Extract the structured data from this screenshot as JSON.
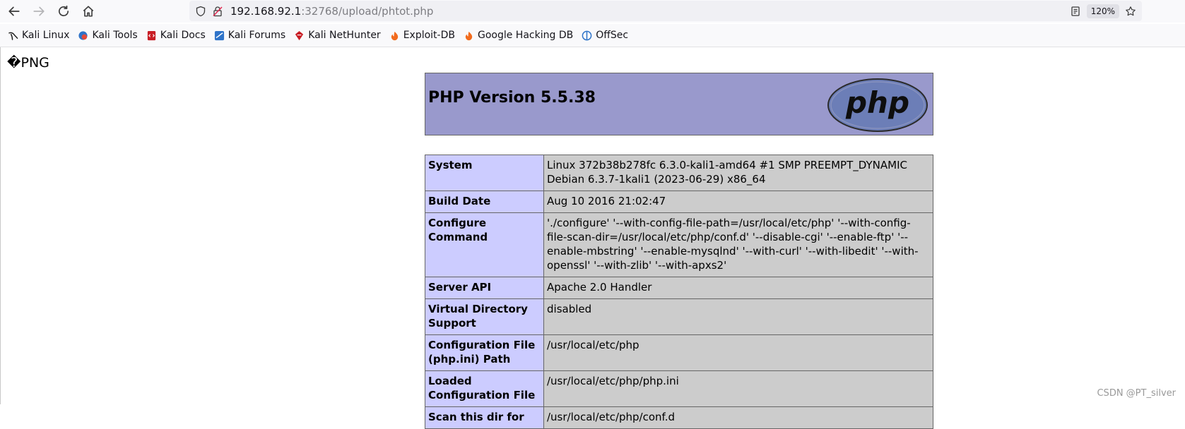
{
  "toolbar": {
    "url_host": "192.168.92.1",
    "url_path": ":32768/upload/phtot.php",
    "zoom": "120%"
  },
  "bookmarks": [
    {
      "label": "Kali Linux",
      "icon": "kali-dragon-icon"
    },
    {
      "label": "Kali Tools",
      "icon": "kali-tools-icon"
    },
    {
      "label": "Kali Docs",
      "icon": "kali-docs-icon"
    },
    {
      "label": "Kali Forums",
      "icon": "kali-forums-icon"
    },
    {
      "label": "Kali NetHunter",
      "icon": "kali-nethunter-icon"
    },
    {
      "label": "Exploit-DB",
      "icon": "exploit-db-icon"
    },
    {
      "label": "Google Hacking DB",
      "icon": "ghdb-icon"
    },
    {
      "label": "OffSec",
      "icon": "offsec-icon"
    }
  ],
  "page": {
    "garbage_text": "�PNG",
    "php_version": "PHP Version 5.5.38",
    "logo_text": "php",
    "rows": [
      {
        "key": "System",
        "value": "Linux 372b38b278fc 6.3.0-kali1-amd64 #1 SMP PREEMPT_DYNAMIC Debian 6.3.7-1kali1 (2023-06-29) x86_64"
      },
      {
        "key": "Build Date",
        "value": "Aug 10 2016 21:02:47"
      },
      {
        "key": "Configure Command",
        "value": "'./configure' '--with-config-file-path=/usr/local/etc/php' '--with-config-file-scan-dir=/usr/local/etc/php/conf.d' '--disable-cgi' '--enable-ftp' '--enable-mbstring' '--enable-mysqlnd' '--with-curl' '--with-libedit' '--with-openssl' '--with-zlib' '--with-apxs2'"
      },
      {
        "key": "Server API",
        "value": "Apache 2.0 Handler"
      },
      {
        "key": "Virtual Directory Support",
        "value": "disabled"
      },
      {
        "key": "Configuration File (php.ini) Path",
        "value": "/usr/local/etc/php"
      },
      {
        "key": "Loaded Configuration File",
        "value": "/usr/local/etc/php/php.ini"
      },
      {
        "key": "Scan this dir for",
        "value": "/usr/local/etc/php/conf.d"
      }
    ],
    "watermark": "CSDN @PT_silver"
  },
  "colors": {
    "php_header_bg": "#9999cc",
    "key_bg": "#ccccff",
    "value_bg": "#cccccc"
  }
}
